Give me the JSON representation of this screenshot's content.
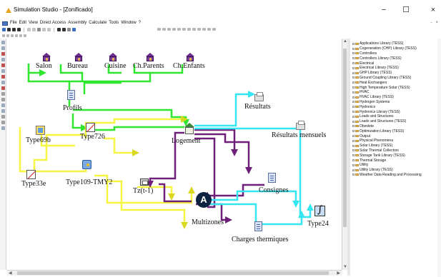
{
  "window": {
    "title": "Simulation Studio - [Zonificado]",
    "minimize_glyph": "−",
    "maximize_glyph": "☐",
    "close_glyph": "×"
  },
  "menu": {
    "items": [
      "File",
      "Edit",
      "View",
      "Direct Access",
      "Assembly",
      "Calculate",
      "Tools",
      "Window",
      "?"
    ],
    "right_controls": [
      "-",
      "×"
    ]
  },
  "canvas": {
    "components": {
      "salon": "Salon",
      "bureau": "Bureau",
      "cuisine": "Cuisine",
      "ch_parents": "Ch.Parents",
      "ch_enfants": "Ch.Enfants",
      "profils": "Profils",
      "type726": "Type726",
      "type69b": "Type69b",
      "type33e": "Type33e",
      "type109": "Type109-TMY2",
      "logement": "Logement",
      "tz": "Tz(t-1)",
      "resultats": "Résultats",
      "resultats_mensuels": "Résultats mensuels",
      "consignes": "Consignes",
      "multizones": "Multizones",
      "charges": "Charges thermiques",
      "type24": "Type24",
      "assembly_badge": "A"
    },
    "wire_colors": {
      "green": "#2ee62e",
      "yellow": "#f5f542",
      "purple": "#6e1f78",
      "cyan": "#33e6f2"
    }
  },
  "library": {
    "items": [
      "Applications Library (TESS)",
      "Cogeneration (CHP) Library (TESS)",
      "Controllers",
      "Controllers Library (TESS)",
      "Electrical",
      "Electrical Library (TESS)",
      "GHP Library (TESS)",
      "Ground Coupling Library (TESS)",
      "Heat Exchangers",
      "High Temperature Solar (TESS)",
      "HVAC",
      "HVAC Library (TESS)",
      "Hydrogen Systems",
      "Hydronics",
      "Hydronics Library (TESS)",
      "Loads and Structures",
      "Loads and Structures (TESS)",
      "Obsolete",
      "Optimization Library (TESS)",
      "Output",
      "Physical Phenomena",
      "Solar Library (TESS)",
      "Solar Thermal Collectors",
      "Storage Tank Library (TESS)",
      "Thermal Storage",
      "Utility",
      "Utility Library (TESS)",
      "Weather Data Reading and Processing"
    ]
  }
}
